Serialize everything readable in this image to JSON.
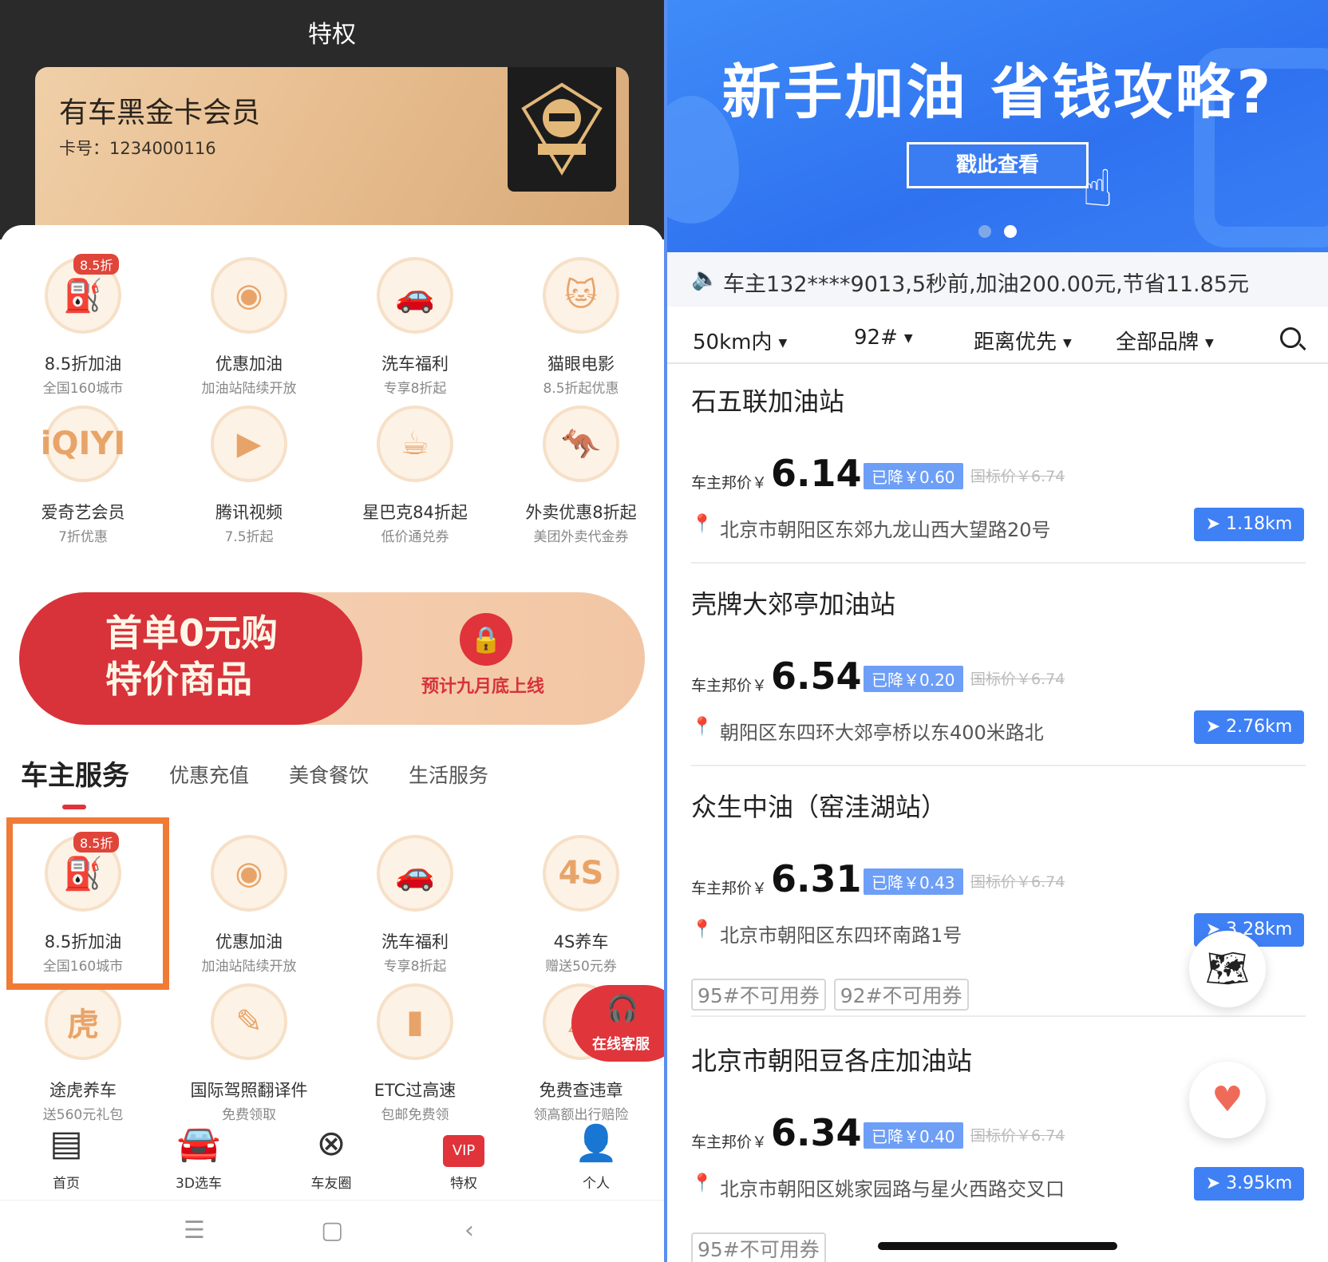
{
  "left": {
    "title": "特权",
    "card": {
      "name": "有车黑金卡会员",
      "number": "卡号：1234000116"
    },
    "grid1": [
      {
        "label": "8.5折加油",
        "sub": "全国160城市",
        "tag": "8.5折",
        "icon": "fuel-pump-icon",
        "glyph": "⛽"
      },
      {
        "label": "优惠加油",
        "sub": "加油站陆续开放",
        "icon": "discount-fuel-icon",
        "glyph": "◉"
      },
      {
        "label": "洗车福利",
        "sub": "专享8折起",
        "icon": "car-wash-icon",
        "glyph": "🚗"
      },
      {
        "label": "猫眼电影",
        "sub": "8.5折起优惠",
        "icon": "cat-eye-icon",
        "glyph": "🐱"
      },
      {
        "label": "爱奇艺会员",
        "sub": "7折优惠",
        "icon": "iqiyi-icon",
        "glyph": "iQIYI"
      },
      {
        "label": "腾讯视频",
        "sub": "7.5折起",
        "icon": "tencent-video-icon",
        "glyph": "▶"
      },
      {
        "label": "星巴克84折起",
        "sub": "低价通兑券",
        "icon": "starbucks-cup-icon",
        "glyph": "☕"
      },
      {
        "label": "外卖优惠8折起",
        "sub": "美团外卖代金券",
        "icon": "delivery-kangaroo-icon",
        "glyph": "🦘"
      }
    ],
    "promo": {
      "line1": "首单0元购",
      "line2": "特价商品",
      "soon": "预计九月底上线"
    },
    "tabs": [
      "车主服务",
      "优惠充值",
      "美食餐饮",
      "生活服务"
    ],
    "grid2": [
      {
        "label": "8.5折加油",
        "sub": "全国160城市",
        "tag": "8.5折",
        "icon": "fuel-pump-icon",
        "glyph": "⛽"
      },
      {
        "label": "优惠加油",
        "sub": "加油站陆续开放",
        "icon": "discount-fuel-icon",
        "glyph": "◉"
      },
      {
        "label": "洗车福利",
        "sub": "专享8折起",
        "icon": "car-wash-icon",
        "glyph": "🚗"
      },
      {
        "label": "4S养车",
        "sub": "赠送50元券",
        "icon": "4s-service-icon",
        "glyph": "4S"
      },
      {
        "label": "途虎养车",
        "sub": "送560元礼包",
        "icon": "tuhu-tiger-icon",
        "glyph": "虎"
      },
      {
        "label": "国际驾照翻译件",
        "sub": "免费领取",
        "icon": "license-translation-icon",
        "glyph": "✎"
      },
      {
        "label": "ETC过高速",
        "sub": "包邮免费领",
        "icon": "etc-card-icon",
        "glyph": "▮"
      },
      {
        "label": "免费查违章",
        "sub": "领高额出行赔险",
        "icon": "violation-check-icon",
        "glyph": "⚠"
      }
    ],
    "customer_service": "在线客服",
    "nav": [
      {
        "label": "首页",
        "glyph": "▤",
        "icon": "home-icon"
      },
      {
        "label": "3D选车",
        "glyph": "🚘",
        "icon": "car-3d-icon"
      },
      {
        "label": "车友圈",
        "glyph": "⊗",
        "icon": "community-icon"
      },
      {
        "label": "特权",
        "glyph": "VIP",
        "icon": "vip-icon"
      },
      {
        "label": "个人",
        "glyph": "👤",
        "icon": "profile-icon"
      }
    ],
    "system": [
      "☰",
      "▢",
      "‹"
    ]
  },
  "right": {
    "banner": {
      "headline": "新手加油 省钱攻略?",
      "button": "戳此查看"
    },
    "notice": "车主132****9013,5秒前,加油200.00元,节省11.85元",
    "filters": [
      "50km内",
      "92#",
      "距离优先",
      "全部品牌"
    ],
    "stations": [
      {
        "name": "石五联加油站",
        "price_label": "车主邦价￥",
        "price": "6.14",
        "drop": "已降￥0.60",
        "national": "国标价￥6.74",
        "address": "北京市朝阳区东郊九龙山西大望路20号",
        "distance": "1.18km",
        "coupons": []
      },
      {
        "name": "壳牌大郊亭加油站",
        "price_label": "车主邦价￥",
        "price": "6.54",
        "drop": "已降￥0.20",
        "national": "国标价￥6.74",
        "address": "朝阳区东四环大郊亭桥以东400米路北",
        "distance": "2.76km",
        "coupons": []
      },
      {
        "name": "众生中油（窑洼湖站）",
        "price_label": "车主邦价￥",
        "price": "6.31",
        "drop": "已降￥0.43",
        "national": "国标价￥6.74",
        "address": "北京市朝阳区东四环南路1号",
        "distance": "3.28km",
        "coupons": [
          "95#不可用券",
          "92#不可用券"
        ]
      },
      {
        "name": "北京市朝阳豆各庄加油站",
        "price_label": "车主邦价￥",
        "price": "6.34",
        "drop": "已降￥0.40",
        "national": "国标价￥6.74",
        "address": "北京市朝阳区姚家园路与星火西路交叉口",
        "distance": "3.95km",
        "coupons": [
          "95#不可用券"
        ]
      }
    ]
  }
}
